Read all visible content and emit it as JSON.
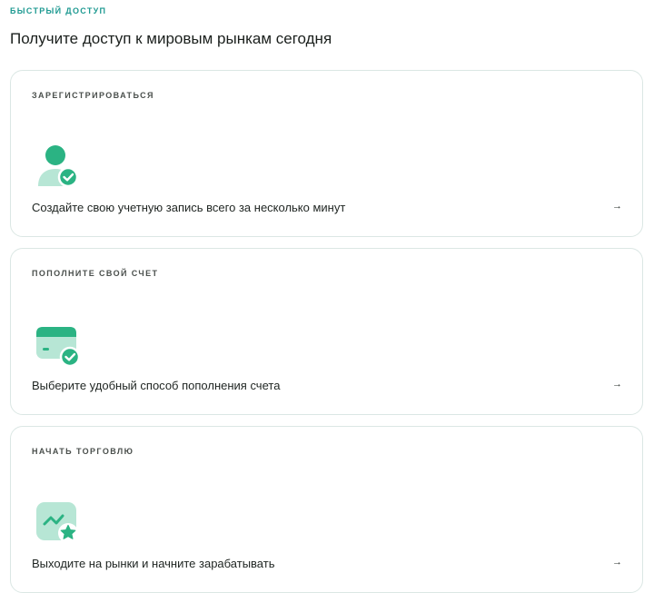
{
  "eyebrow": "БЫСТРЫЙ ДОСТУП",
  "headline": "Получите доступ к мировым рынкам сегодня",
  "colors": {
    "accent": "#2bb383",
    "accent_light": "#b7e6d5",
    "eyebrow": "#1f9a92",
    "card_border": "#dbe7e4"
  },
  "cards": [
    {
      "title": "ЗАРЕГИСТРИРОВАТЬСЯ",
      "icon": "user-check-icon",
      "text": "Создайте свою учетную запись всего за несколько минут",
      "arrow": "→"
    },
    {
      "title": "ПОПОЛНИТЕ СВОЙ СЧЕТ",
      "icon": "card-check-icon",
      "text": "Выберите удобный способ пополнения счета",
      "arrow": "→"
    },
    {
      "title": "НАЧАТЬ ТОРГОВЛЮ",
      "icon": "chart-star-icon",
      "text": "Выходите на рынки и начните зарабатывать",
      "arrow": "→"
    }
  ]
}
